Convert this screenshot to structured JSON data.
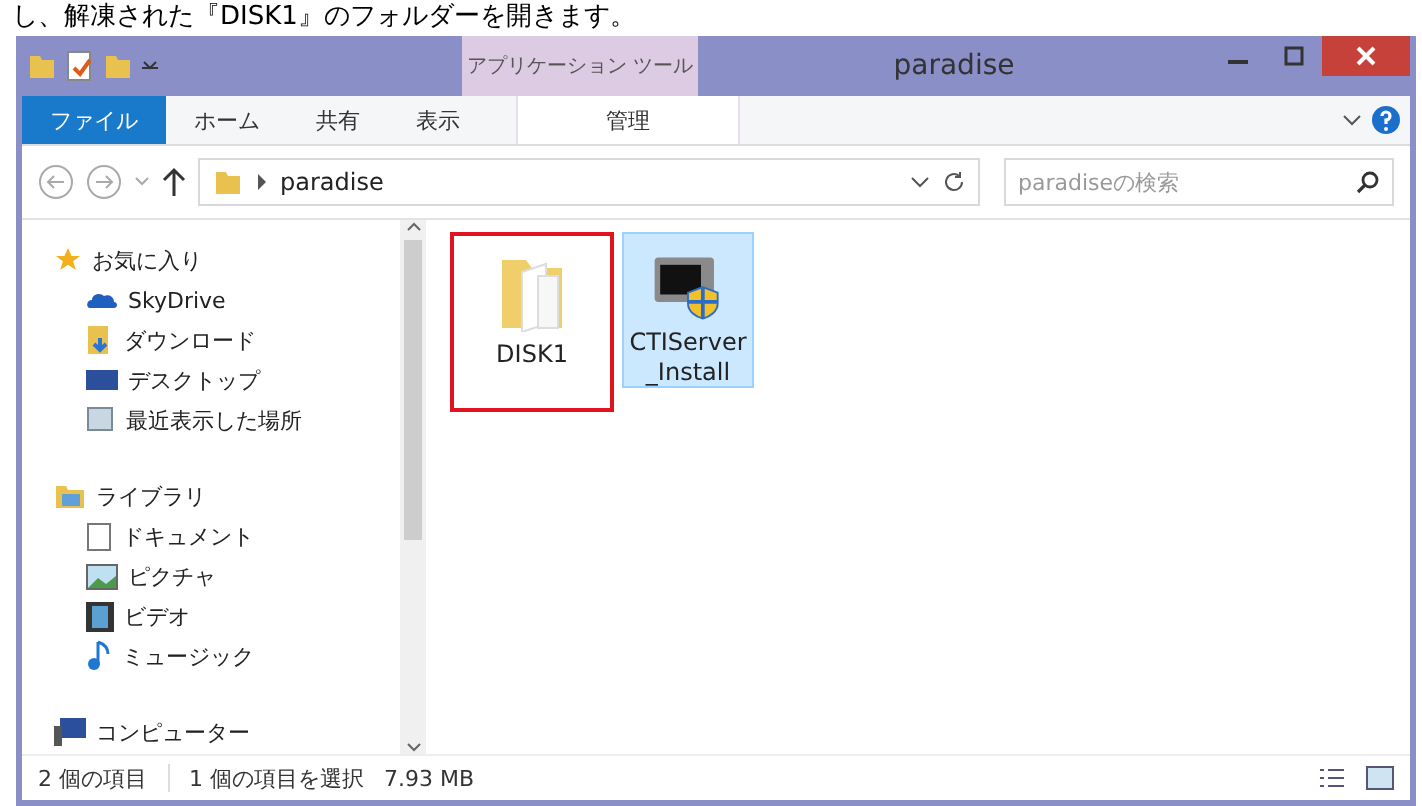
{
  "caption": "し、解凍された『DISK1』のフォルダーを開きます。",
  "window": {
    "title": "paradise",
    "context_tab": "アプリケーション ツール"
  },
  "ribbon_tabs": [
    {
      "label": "ファイル",
      "selected": true,
      "kind": "file"
    },
    {
      "label": "ホーム",
      "selected": false,
      "kind": "tab"
    },
    {
      "label": "共有",
      "selected": false,
      "kind": "tab"
    },
    {
      "label": "表示",
      "selected": false,
      "kind": "tab"
    },
    {
      "label": "管理",
      "selected": false,
      "kind": "context"
    }
  ],
  "address": {
    "path": "paradise"
  },
  "search": {
    "placeholder": "paradiseの検索"
  },
  "nav_groups": [
    {
      "label": "お気に入り",
      "kind": "star",
      "items": [
        {
          "label": "SkyDrive",
          "kind": "cloud"
        },
        {
          "label": "ダウンロード",
          "kind": "download"
        },
        {
          "label": "デスクトップ",
          "kind": "desktop"
        },
        {
          "label": "最近表示した場所",
          "kind": "recent"
        }
      ]
    },
    {
      "label": "ライブラリ",
      "kind": "library",
      "items": [
        {
          "label": "ドキュメント",
          "kind": "document"
        },
        {
          "label": "ピクチャ",
          "kind": "picture"
        },
        {
          "label": "ビデオ",
          "kind": "video"
        },
        {
          "label": "ミュージック",
          "kind": "music"
        }
      ]
    },
    {
      "label": "コンピューター",
      "kind": "computer"
    }
  ],
  "files": [
    {
      "name": "DISK1",
      "kind": "folder",
      "selected": false,
      "highlighted": true
    },
    {
      "name": "CTIServer\n_Install",
      "kind": "installer",
      "selected": true,
      "highlighted": false
    }
  ],
  "status_bar": {
    "count": "2 個の項目",
    "selection": "1 個の項目を選択",
    "size": "7.93 MB"
  }
}
